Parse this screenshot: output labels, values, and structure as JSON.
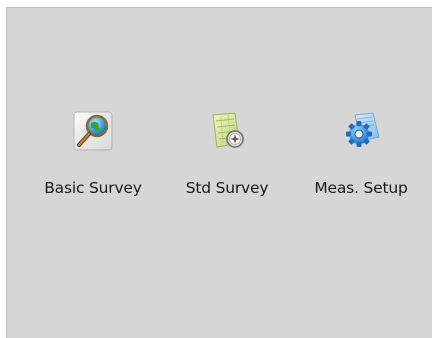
{
  "desktop": {
    "apps": [
      {
        "label": "Basic Survey",
        "icon": "magnifier-globe-icon"
      },
      {
        "label": "Std Survey",
        "icon": "map-compass-icon"
      },
      {
        "label": "Meas. Setup",
        "icon": "folder-gear-icon"
      }
    ]
  },
  "colors": {
    "background": "#d6d6d6",
    "frame": "#ffffff",
    "text": "#1a1a1a"
  }
}
